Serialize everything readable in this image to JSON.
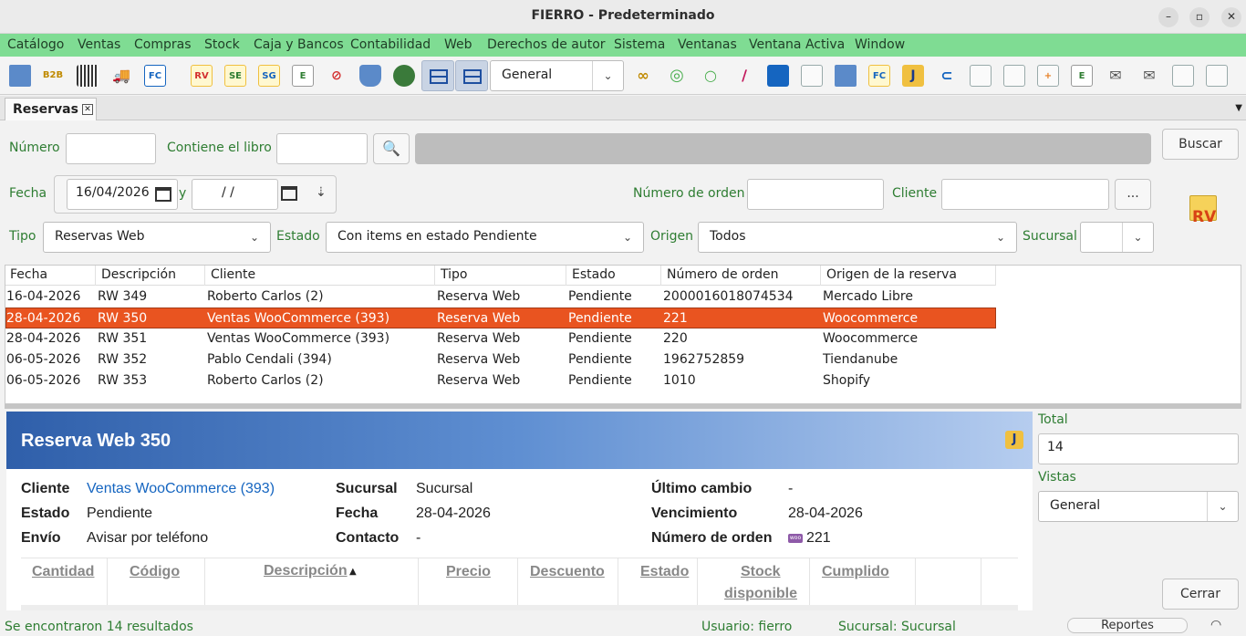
{
  "window": {
    "title": "FIERRO - Predeterminado"
  },
  "menu": [
    "Catálogo",
    "Ventas",
    "Compras",
    "Stock",
    "Caja y Bancos",
    "Contabilidad",
    "Web",
    "Derechos de autor",
    "Sistema",
    "Ventanas",
    "Ventana Activa",
    "Window"
  ],
  "toolbar": {
    "combo_value": "General",
    "icons": {
      "b2b": "B2B",
      "fc": "FC",
      "rv": "RV",
      "se": "SE",
      "sg": "SG",
      "e": "E",
      "fc2": "FC",
      "e2": "E"
    }
  },
  "tab": {
    "label": "Reservas"
  },
  "filters": {
    "numero_label": "Número",
    "numero_value": "",
    "libro_label": "Contiene el libro",
    "libro_value": "",
    "buscar": "Buscar",
    "fecha_label": "Fecha",
    "fecha_desde": "16/04/2026",
    "y": "y",
    "fecha_hasta": " / /",
    "orden_label": "Número de orden",
    "orden_value": "",
    "cliente_label": "Cliente",
    "cliente_value": "",
    "ellipsis": "...",
    "tipo_label": "Tipo",
    "tipo_value": "Reservas Web",
    "estado_label": "Estado",
    "estado_value": "Con items en estado Pendiente",
    "origen_label": "Origen",
    "origen_value": "Todos",
    "sucursal_label": "Sucursal",
    "sucursal_value": "",
    "rv_badge": "RV"
  },
  "grid": {
    "columns": [
      "Fecha",
      "Descripción",
      "Cliente",
      "Tipo",
      "Estado",
      "Número de orden",
      "Origen de la reserva"
    ],
    "rows": [
      [
        "16-04-2026",
        "RW 349",
        "Roberto Carlos (2)",
        "Reserva Web",
        "Pendiente",
        "2000016018074534",
        "Mercado Libre"
      ],
      [
        "28-04-2026",
        "RW 350",
        "Ventas WooCommerce (393)",
        "Reserva Web",
        "Pendiente",
        "221",
        "Woocommerce"
      ],
      [
        "28-04-2026",
        "RW 351",
        "Ventas WooCommerce (393)",
        "Reserva Web",
        "Pendiente",
        "220",
        "Woocommerce"
      ],
      [
        "06-05-2026",
        "RW 352",
        "Pablo Cendali (394)",
        "Reserva Web",
        "Pendiente",
        "1962752859",
        "Tiendanube"
      ],
      [
        "06-05-2026",
        "RW 353",
        "Roberto Carlos (2)",
        "Reserva Web",
        "Pendiente",
        "1010",
        "Shopify"
      ]
    ],
    "selected_row": 1
  },
  "detail": {
    "title": "Reserva Web 350",
    "cliente_label": "Cliente",
    "cliente_value": "Ventas WooCommerce (393)",
    "estado_label": "Estado",
    "estado_value": "Pendiente",
    "envio_label": "Envío",
    "envio_value": "Avisar por teléfono",
    "sucursal_label": "Sucursal",
    "sucursal_value": "Sucursal",
    "fecha_label": "Fecha",
    "fecha_value": "28-04-2026",
    "contacto_label": "Contacto",
    "contacto_value": "-",
    "ultimo_label": "Último cambio",
    "ultimo_value": "-",
    "venc_label": "Vencimiento",
    "venc_value": "28-04-2026",
    "orden_label": "Número de orden",
    "orden_value": "221",
    "woo_badge": "woo",
    "columns": [
      "Cantidad",
      "Código",
      "Descripción",
      "Precio",
      "Descuento",
      "Estado",
      "Stock",
      "disponible",
      "Cumplido"
    ],
    "sort_arrow": "▲"
  },
  "side": {
    "total_label": "Total",
    "total_value": "14",
    "vistas_label": "Vistas",
    "vistas_value": "General",
    "cerrar": "Cerrar"
  },
  "status": {
    "results": "Se encontraron 14 resultados",
    "usuario": "Usuario: fierro",
    "sucursal": "Sucursal: Sucursal",
    "reportes": "Reportes"
  },
  "colors": {
    "menubar": "#7fdc93",
    "selected_row": "#e95420",
    "label_green": "#2e7d32",
    "banner": "#2f5faa"
  }
}
